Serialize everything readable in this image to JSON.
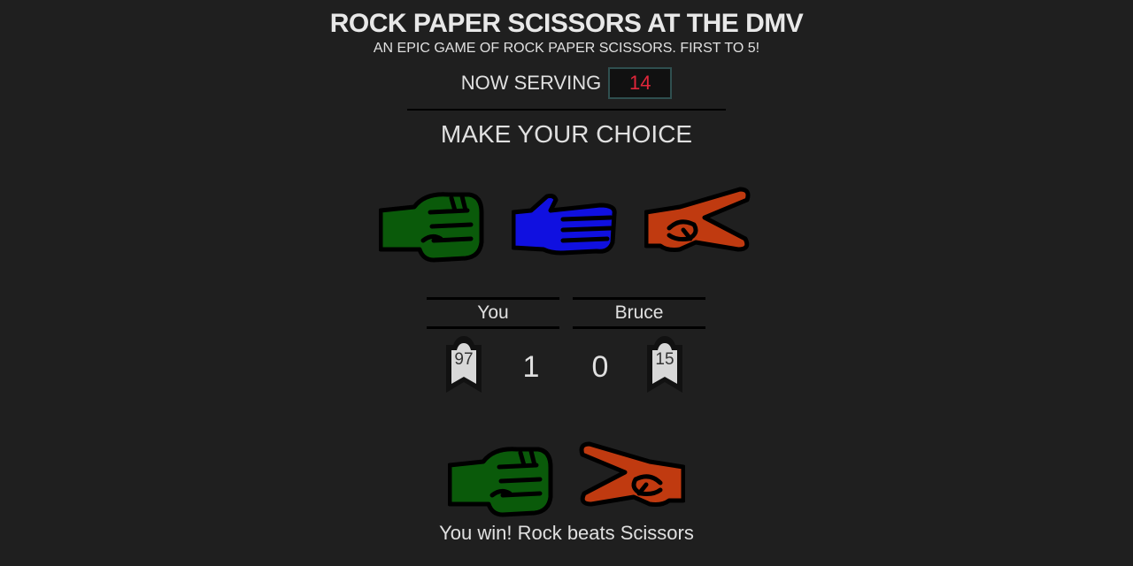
{
  "header": {
    "title": "ROCK PAPER SCISSORS AT THE DMV",
    "subtitle": "AN EPIC GAME OF ROCK PAPER SCISSORS. FIRST TO 5!",
    "serving_label": "NOW SERVING",
    "serving_number": "14"
  },
  "choices": {
    "heading": "MAKE YOUR CHOICE",
    "items": [
      {
        "name": "rock",
        "color": "#0a5a0a",
        "icon": "rock-fist-icon"
      },
      {
        "name": "paper",
        "color": "#1010e0",
        "icon": "paper-hand-icon"
      },
      {
        "name": "scissors",
        "color": "#c03a10",
        "icon": "scissors-hand-icon"
      }
    ]
  },
  "scoreboard": {
    "player": {
      "label": "You",
      "ticket": "97",
      "score": "1"
    },
    "opponent": {
      "label": "Bruce",
      "ticket": "15",
      "score": "0"
    }
  },
  "round": {
    "player_choice": "rock",
    "opponent_choice": "scissors",
    "result": "You win! Rock beats Scissors"
  },
  "colors": {
    "background": "#1f1f1f",
    "serving_number": "#e0263a",
    "rock": "#0a5a0a",
    "paper": "#1010e0",
    "scissors": "#c03a10"
  }
}
